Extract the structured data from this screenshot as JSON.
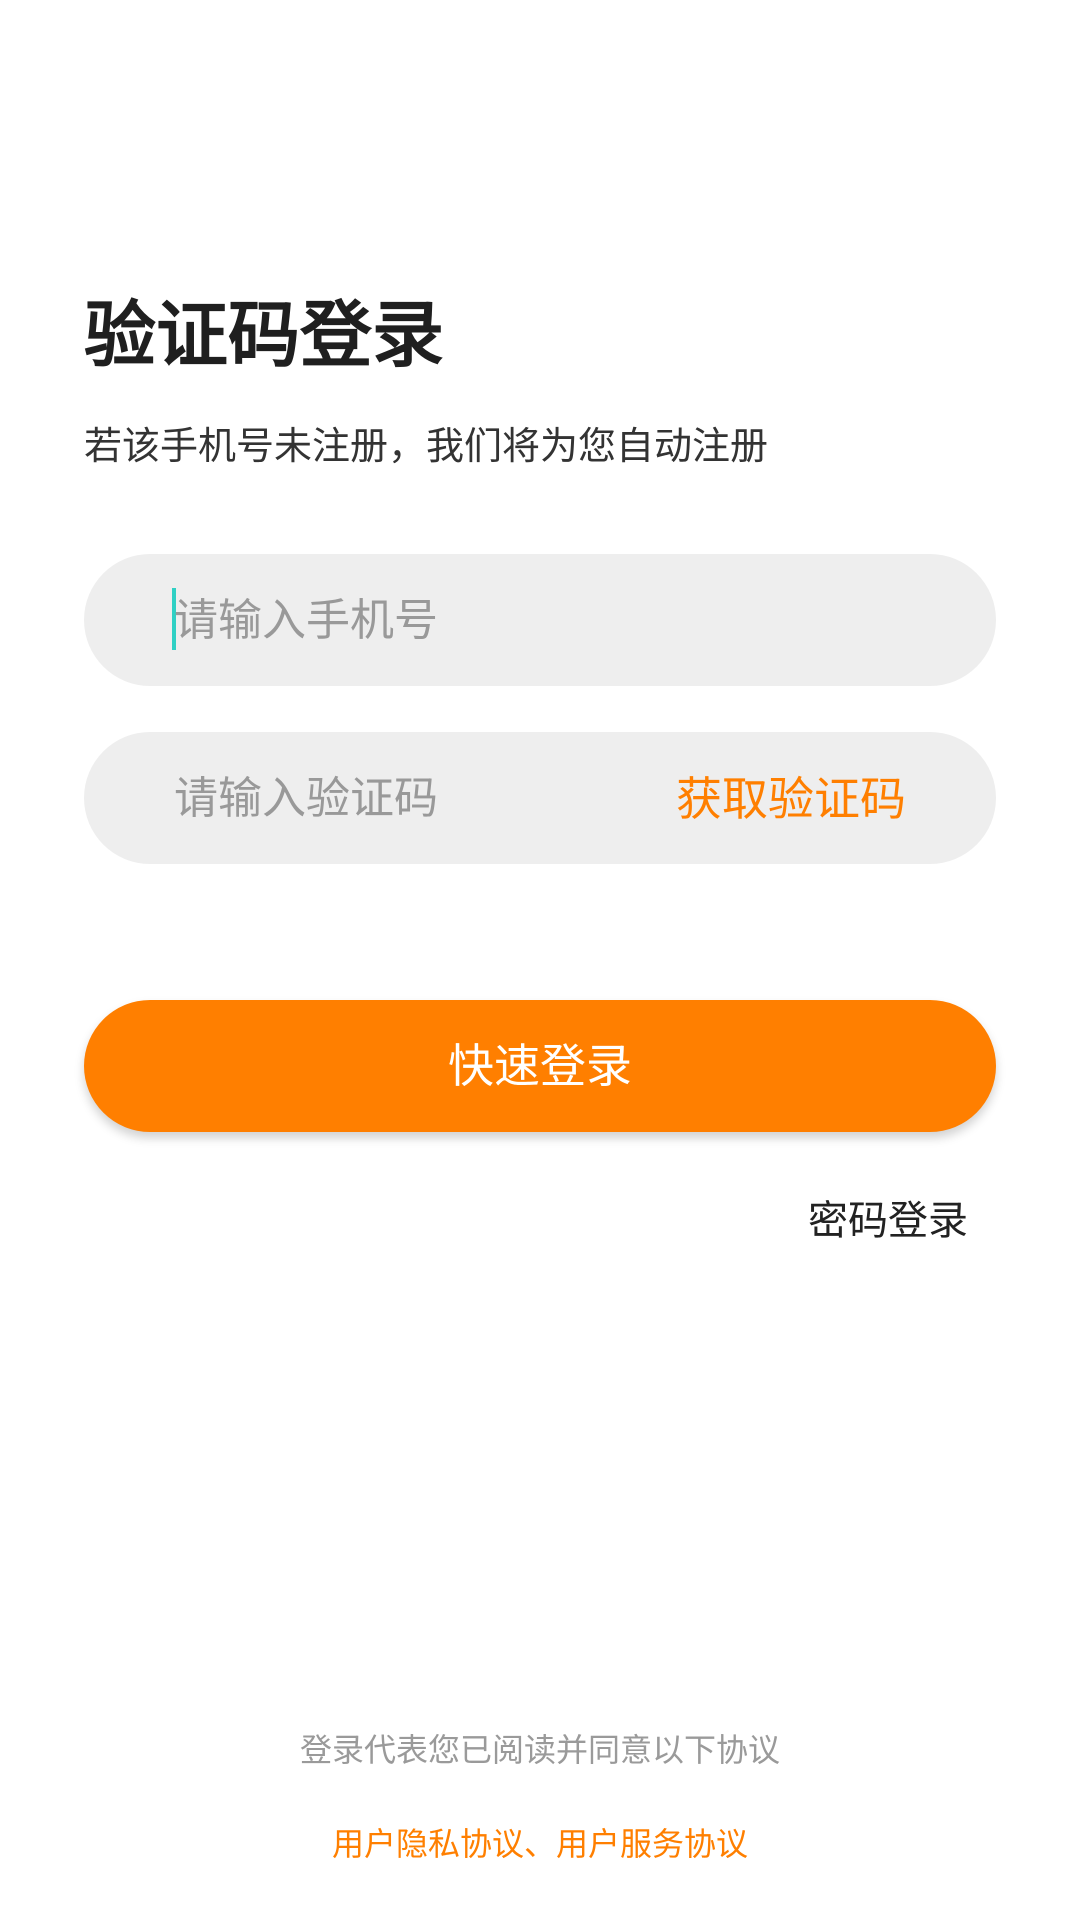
{
  "header": {
    "title": "验证码登录",
    "subtitle": "若该手机号未注册，我们将为您自动注册"
  },
  "form": {
    "phone_placeholder": "请输入手机号",
    "code_placeholder": "请输入验证码",
    "get_code_label": "获取验证码"
  },
  "actions": {
    "quick_login_label": "快速登录",
    "password_login_label": "密码登录"
  },
  "footer": {
    "agree_text": "登录代表您已阅读并同意以下协议",
    "privacy_label": "用户隐私协议",
    "separator": "、",
    "service_label": "用户服务协议"
  },
  "colors": {
    "accent": "#ff7f00",
    "field_bg": "#eeeeee",
    "cursor": "#2fd0c4"
  }
}
